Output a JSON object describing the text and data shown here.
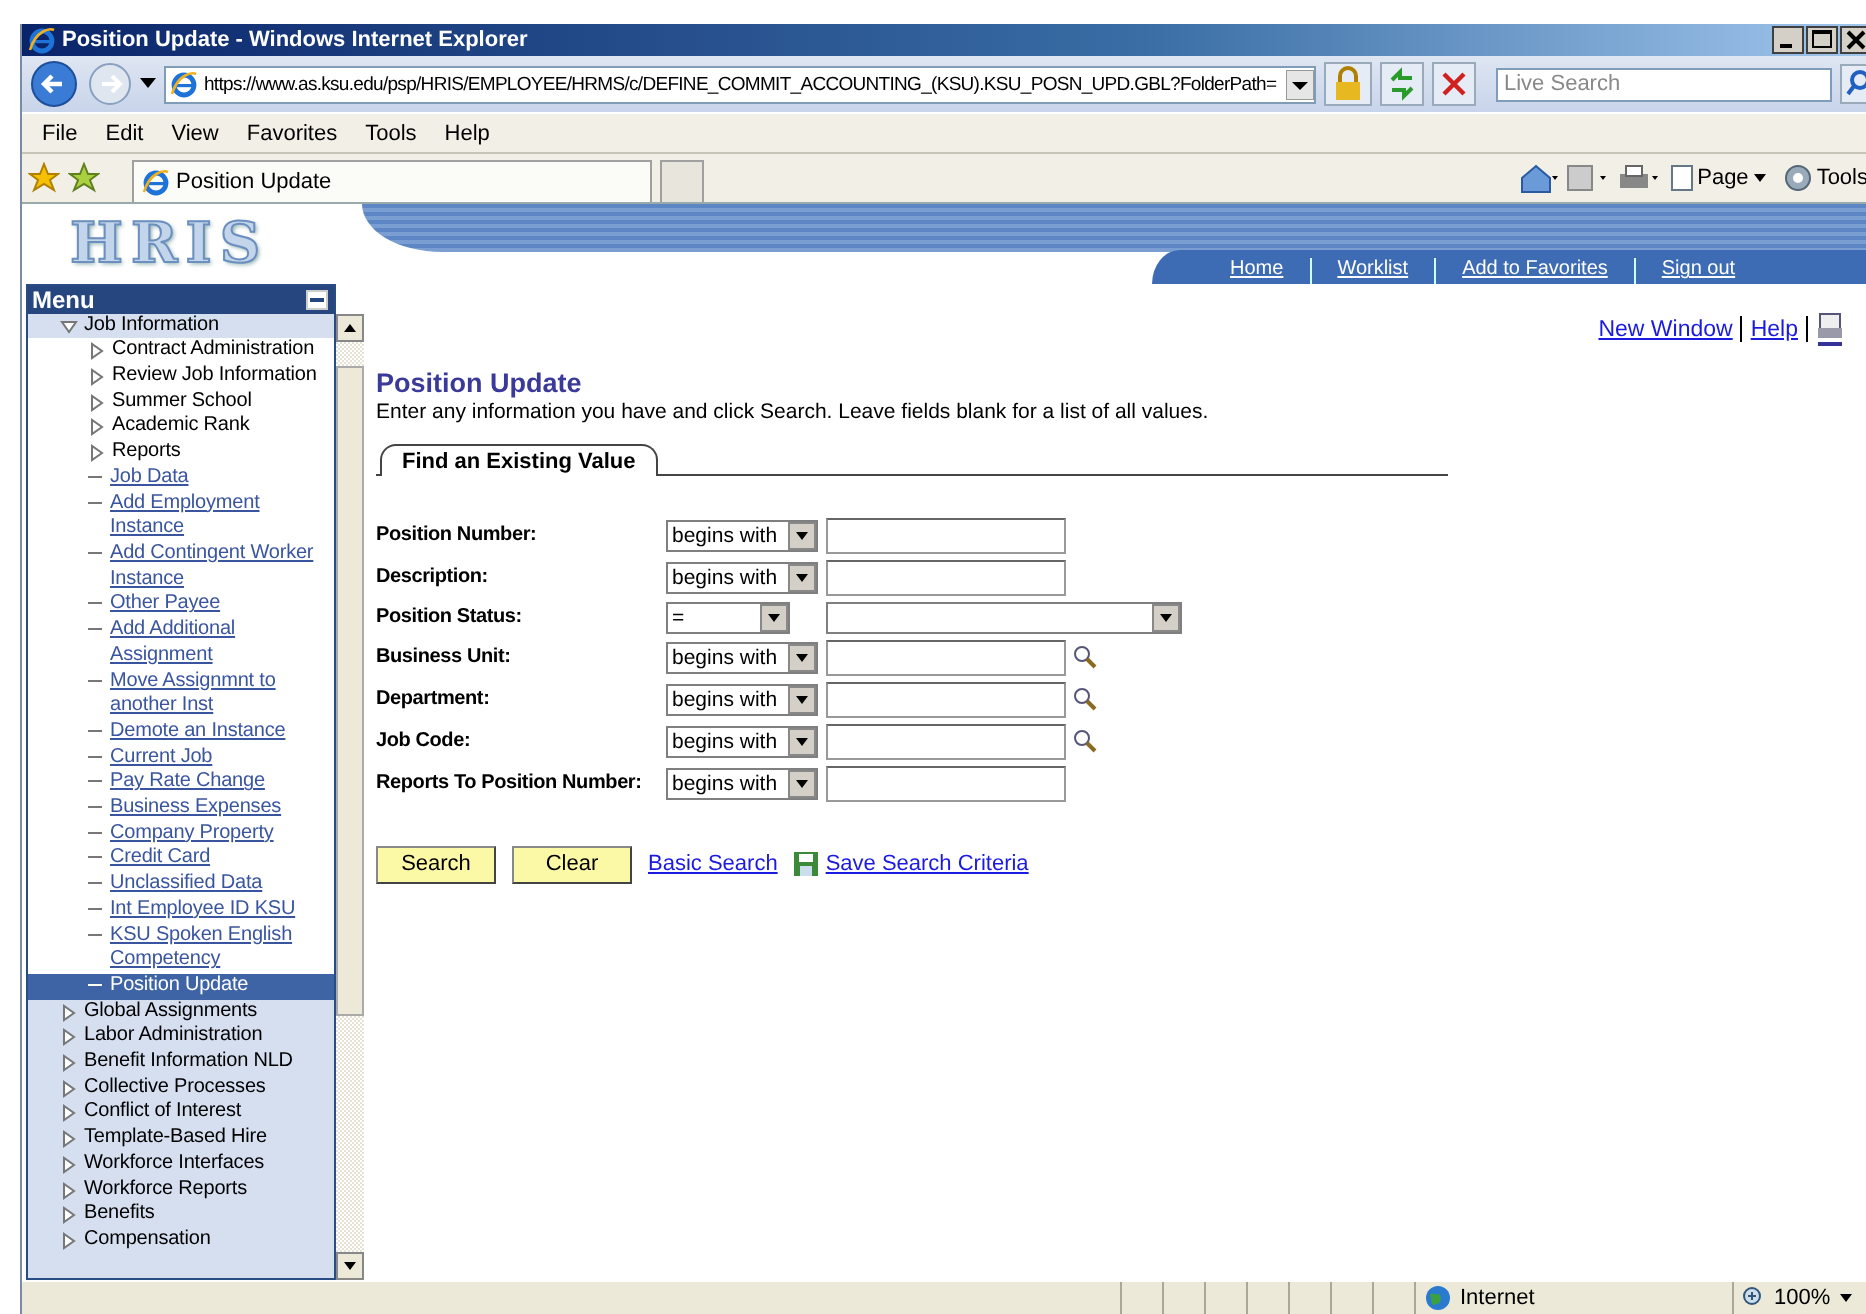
{
  "window": {
    "title": "Position Update - Windows Internet Explorer"
  },
  "toolbar": {
    "address": "https://www.as.ksu.edu/psp/HRIS/EMPLOYEE/HRMS/c/DEFINE_COMMIT_ACCOUNTING_(KSU).KSU_POSN_UPD.GBL?FolderPath=",
    "search_placeholder": "Live Search"
  },
  "menu_bar": [
    "File",
    "Edit",
    "View",
    "Favorites",
    "Tools",
    "Help"
  ],
  "tab": {
    "label": "Position Update"
  },
  "command_bar": [
    "Page",
    "Tools"
  ],
  "banner": {
    "logo": "HRIS",
    "nav_links": [
      "Home",
      "Worklist",
      "Add to Favorites",
      "Sign out"
    ]
  },
  "sidebar": {
    "title": "Menu",
    "items": [
      {
        "children": [
          {
            "label": "Job Information",
            "kind": "folder",
            "expanded": true,
            "children": [
              {
                "label": "Contract Administration",
                "kind": "folder",
                "expanded": false
              },
              {
                "label": "Review Job Information",
                "kind": "folder",
                "expanded": false
              },
              {
                "label": "Summer School",
                "kind": "folder",
                "expanded": false
              },
              {
                "label": "Academic Rank",
                "kind": "folder",
                "expanded": false
              },
              {
                "label": "Reports",
                "kind": "folder",
                "expanded": false
              },
              {
                "label": "Job Data",
                "kind": "link",
                "selected": false
              },
              {
                "label": "Add Employment Instance",
                "kind": "link",
                "selected": false
              },
              {
                "label": "Add Contingent Worker Instance",
                "kind": "link",
                "selected": false
              },
              {
                "label": "Other Payee",
                "kind": "link",
                "selected": false
              },
              {
                "label": "Add Additional Assignment",
                "kind": "link",
                "selected": false
              },
              {
                "label": "Move Assignmnt to another Inst",
                "kind": "link",
                "selected": false
              },
              {
                "label": "Demote an Instance",
                "kind": "link",
                "selected": false
              },
              {
                "label": "Current Job",
                "kind": "link",
                "selected": false
              },
              {
                "label": "Pay Rate Change",
                "kind": "link",
                "selected": false
              },
              {
                "label": "Business Expenses",
                "kind": "link",
                "selected": false
              },
              {
                "label": "Company Property",
                "kind": "link",
                "selected": false
              },
              {
                "label": "Credit Card",
                "kind": "link",
                "selected": false
              },
              {
                "label": "Unclassified Data",
                "kind": "link",
                "selected": false
              },
              {
                "label": "Int Employee ID KSU",
                "kind": "link",
                "selected": false
              },
              {
                "label": "KSU Spoken English Competency",
                "kind": "link",
                "selected": false
              },
              {
                "label": "Position Update",
                "kind": "link",
                "selected": true
              }
            ]
          },
          {
            "label": "Global Assignments",
            "kind": "folder",
            "expanded": false
          },
          {
            "label": "Labor Administration",
            "kind": "folder",
            "expanded": false
          },
          {
            "label": "Benefit Information NLD",
            "kind": "folder",
            "expanded": false
          },
          {
            "label": "Collective Processes",
            "kind": "folder",
            "expanded": false
          },
          {
            "label": "Conflict of Interest",
            "kind": "folder",
            "expanded": false
          },
          {
            "label": "Template-Based Hire",
            "kind": "folder",
            "expanded": false
          },
          {
            "label": "Workforce Interfaces",
            "kind": "folder",
            "expanded": false
          },
          {
            "label": "Workforce Reports",
            "kind": "folder",
            "expanded": false
          }
        ]
      },
      {
        "label": "Benefits",
        "kind": "folder",
        "expanded": false
      },
      {
        "label": "Compensation",
        "kind": "folder",
        "expanded": false
      }
    ]
  },
  "content": {
    "top_links": [
      "New Window",
      "Help"
    ],
    "heading": "Position Update",
    "instructions": "Enter any information you have and click Search. Leave fields blank for a list of all values.",
    "tab": "Find an Existing Value",
    "fields": [
      {
        "label": "Position Number:",
        "operator": "begins with",
        "kind": "text",
        "lookup": false
      },
      {
        "label": "Description:",
        "operator": "begins with",
        "kind": "text",
        "lookup": false
      },
      {
        "label": "Position Status:",
        "operator": "=",
        "kind": "select",
        "lookup": false
      },
      {
        "label": "Business Unit:",
        "operator": "begins with",
        "kind": "text",
        "lookup": true
      },
      {
        "label": "Department:",
        "operator": "begins with",
        "kind": "text",
        "lookup": true
      },
      {
        "label": "Job Code:",
        "operator": "begins with",
        "kind": "text",
        "lookup": true
      },
      {
        "label": "Reports To Position Number:",
        "operator": "begins with",
        "kind": "text",
        "lookup": false
      }
    ],
    "buttons": [
      "Search",
      "Clear"
    ],
    "links": [
      "Basic Search",
      "Save Search Criteria"
    ]
  },
  "status_bar": {
    "zone": "Internet",
    "zoom": "100%"
  }
}
